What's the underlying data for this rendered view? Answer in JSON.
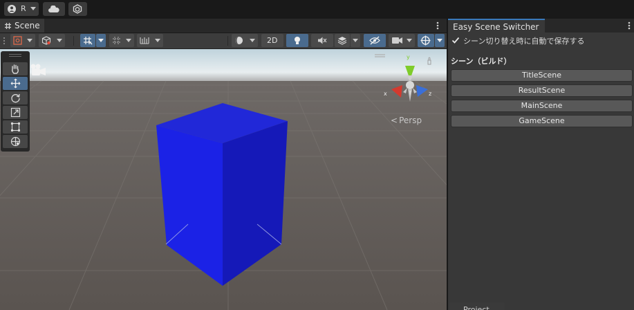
{
  "topbar": {
    "account_label": "R"
  },
  "scene_panel": {
    "tab_label": "Scene",
    "toolbar": {
      "mode_2d_label": "2D"
    },
    "persp_label": "Persp",
    "gizmo": {
      "x_label": "x",
      "y_label": "y",
      "z_label": "z"
    }
  },
  "easy_scene_switcher": {
    "tab_label": "Easy Scene Switcher",
    "autosave_label": "シーン切り替え時に自動で保存する",
    "autosave_checked": true,
    "build_section_title": "シーン（ビルド）",
    "scenes": [
      {
        "label": "TitleScene"
      },
      {
        "label": "ResultScene"
      },
      {
        "label": "MainScene"
      },
      {
        "label": "GameScene"
      }
    ]
  },
  "bottom_tab": {
    "label": "Project"
  },
  "colors": {
    "accent_blue": "#4a6b8e",
    "cube": "#1a22e0",
    "gizmo_x": "#d33a2f",
    "gizmo_y": "#7fcc2a",
    "gizmo_z": "#3a6fd8"
  }
}
